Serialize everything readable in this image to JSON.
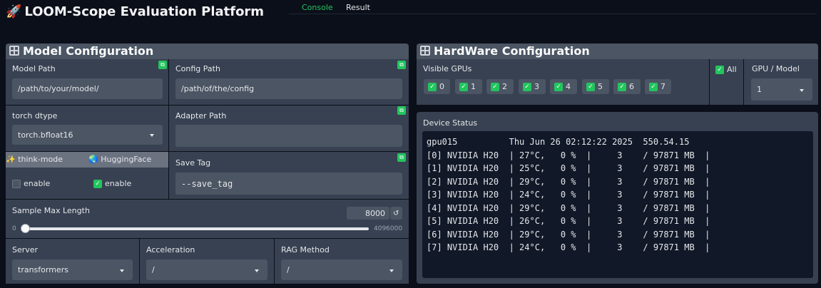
{
  "header": {
    "title": "LOOM-Scope Evaluation Platform",
    "tabs": [
      {
        "label": "Console",
        "active": true
      },
      {
        "label": "Result",
        "active": false
      }
    ]
  },
  "model_config": {
    "title": "Model Configuration",
    "model_path": {
      "label": "Model Path",
      "value": "/path/to/your/model/"
    },
    "config_path": {
      "label": "Config Path",
      "value": "/path/of/the/config"
    },
    "torch_dtype": {
      "label": "torch dtype",
      "value": "torch.bfloat16"
    },
    "adapter_path": {
      "label": "Adapter Path",
      "value": ""
    },
    "think_mode": {
      "label": "think-mode",
      "option": "enable",
      "checked": false
    },
    "huggingface": {
      "label": "HuggingFace",
      "option": "enable",
      "checked": true
    },
    "save_tag": {
      "label": "Save Tag",
      "value": "--save_tag"
    },
    "sample_max_length": {
      "label": "Sample Max Length",
      "value": "8000",
      "min": "0",
      "max": "4096000"
    },
    "server": {
      "label": "Server",
      "value": "transformers"
    },
    "acceleration": {
      "label": "Acceleration",
      "value": "/"
    },
    "rag_method": {
      "label": "RAG Method",
      "value": "/"
    }
  },
  "hardware_config": {
    "title": "HardWare Configuration",
    "visible_gpus_label": "Visible GPUs",
    "gpus": [
      "0",
      "1",
      "2",
      "3",
      "4",
      "5",
      "6",
      "7"
    ],
    "all_label": "All",
    "gpu_per_model": {
      "label": "GPU / Model",
      "value": "1"
    },
    "device_status_label": "Device Status",
    "status_lines": [
      "gpu015          Thu Jun 26 02:12:22 2025  550.54.15",
      "[0] NVIDIA H20  | 27°C,   0 %  |     3    / 97871 MB  |",
      "[1] NVIDIA H20  | 25°C,   0 %  |     3    / 97871 MB  |",
      "[2] NVIDIA H20  | 29°C,   0 %  |     3    / 97871 MB  |",
      "[3] NVIDIA H20  | 24°C,   0 %  |     3    / 97871 MB  |",
      "[4] NVIDIA H20  | 29°C,   0 %  |     3    / 97871 MB  |",
      "[5] NVIDIA H20  | 26°C,   0 %  |     3    / 97871 MB  |",
      "[6] NVIDIA H20  | 29°C,   0 %  |     3    / 97871 MB  |",
      "[7] NVIDIA H20  | 24°C,   0 %  |     3    / 97871 MB  |"
    ]
  },
  "colors": {
    "accent": "#22c55e",
    "panel": "#374151",
    "field": "#4b5563",
    "background": "#0b0f19"
  }
}
